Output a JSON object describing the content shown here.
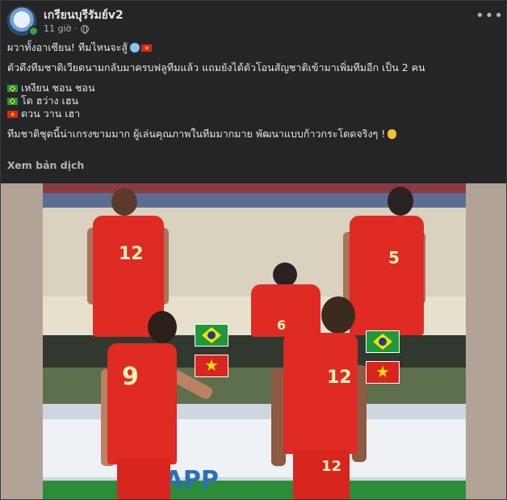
{
  "post": {
    "page_name": "เกรียนบุรีรัมย์v2",
    "time": "11 giờ",
    "separator": "·",
    "more_label": "•••",
    "lines": {
      "l1": "ผวาทั้งอาเซียน! ทีมไหนจะสู้",
      "l2": "ตัวดึงทีมชาติเวียดนามกลับมาครบฟลูทีมแล้ว แถมยังได้ตัวโอนสัญชาติเข้ามาเพิ่มทีมอีก เป็น 2 คน",
      "l3": "เหงียน ชอน ชอน",
      "l4": "โด ฮว่าง เฮน",
      "l5": "ดวน วาน เฮา",
      "l6": "ทีมชาติชุดนี้น่าเกรงขามมาก ผู้เล่นคุณภาพในทีมมากมาย พัฒนาแบบก้าวกระโดดจริงๆ !"
    },
    "see_translation": "Xem bản dịch"
  },
  "image": {
    "banner_text": "VP  APP",
    "numbers": {
      "p1": "12",
      "p2": "5",
      "p3": "6",
      "p4": "9",
      "p5": "12",
      "p5_shorts": "12"
    }
  },
  "icons": [
    "globe-icon",
    "more-icon",
    "flag-vietnam-icon",
    "flag-brazil-icon",
    "scared-face-icon",
    "clap-icon"
  ],
  "colors": {
    "background": "#242526",
    "text": "#e4e6eb",
    "muted": "#b0b3b8",
    "jersey": "#e02a24"
  }
}
